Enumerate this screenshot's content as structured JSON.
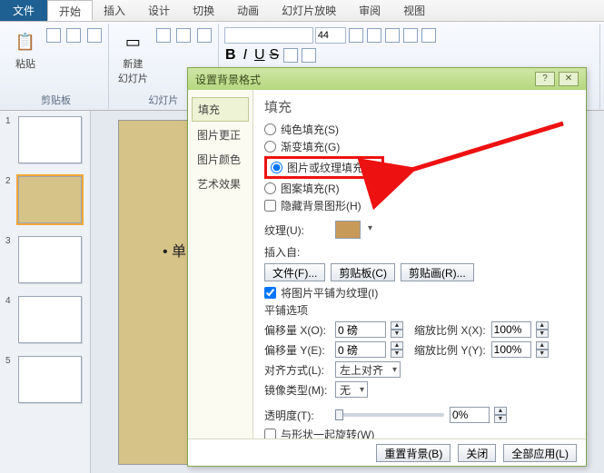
{
  "tabs": {
    "file": "文件",
    "home": "开始",
    "insert": "插入",
    "design": "设计",
    "transition": "切换",
    "animation": "动画",
    "slideshow": "幻灯片放映",
    "review": "审阅",
    "view": "视图"
  },
  "ribbon": {
    "clipboard": {
      "paste": "粘贴",
      "label": "剪贴板"
    },
    "slides": {
      "new": "新建\n幻灯片",
      "label": "幻灯片"
    },
    "font_size": "44"
  },
  "thumbs": [
    "1",
    "2",
    "3",
    "4",
    "5"
  ],
  "dialog": {
    "title": "设置背景格式",
    "side": {
      "fill": "填充",
      "picture_fix": "图片更正",
      "picture_color": "图片颜色",
      "artistic": "艺术效果"
    },
    "section": "填充",
    "opts": {
      "solid": "纯色填充(S)",
      "gradient": "渐变填充(G)",
      "pic": "图片或纹理填充(P)",
      "pattern": "图案填充(R)",
      "hide": "隐藏背景图形(H)"
    },
    "texture_label": "纹理(U):",
    "insert_from": "插入自:",
    "file_btn": "文件(F)...",
    "clipboard_btn": "剪贴板(C)",
    "clipart_btn": "剪贴画(R)...",
    "tile": "将图片平铺为纹理(I)",
    "tile_opts_label": "平铺选项",
    "offset_x": "偏移量 X(O):",
    "offset_y": "偏移量 Y(E):",
    "scale_x": "缩放比例 X(X):",
    "scale_y": "缩放比例 Y(Y):",
    "zero_pt": "0 磅",
    "pct": "100%",
    "align": "对齐方式(L):",
    "align_val": "左上对齐",
    "mirror": "镜像类型(M):",
    "mirror_val": "无",
    "transparency": "透明度(T):",
    "trans_val": "0%",
    "rotate": "与形状一起旋转(W)",
    "reset": "重置背景(B)",
    "close": "关闭",
    "apply_all": "全部应用(L)"
  }
}
